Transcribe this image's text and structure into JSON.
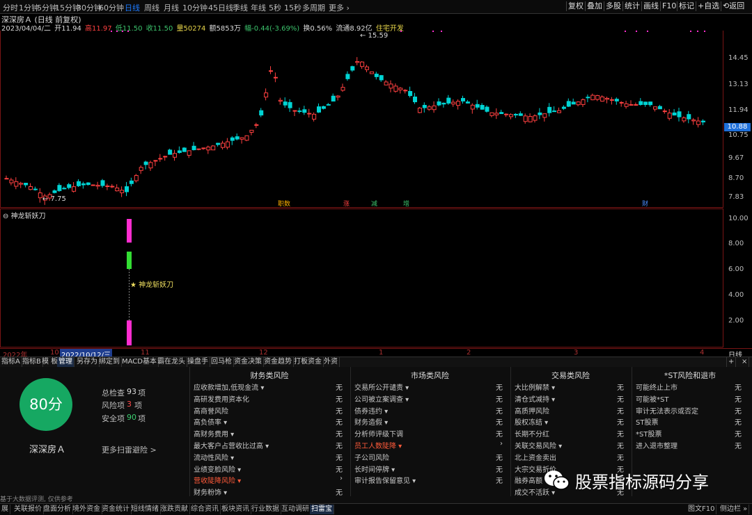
{
  "period_bar": {
    "items": [
      "分时",
      "1分钟",
      "5分钟",
      "15分钟",
      "30分钟",
      "60分钟",
      "日线",
      "周线",
      "月线",
      "10分钟",
      "45日线",
      "季线",
      "年线",
      "5秒",
      "15秒",
      "多周期",
      "更多 ›"
    ],
    "selected": "日线",
    "right_items": [
      "复权",
      "叠加",
      "多股",
      "统计",
      "画线",
      "F10",
      "标记",
      "+自选",
      "⟲返回"
    ]
  },
  "info": {
    "title": "深深房Ａ (日线 前复权)",
    "date": "2023/04/04/二",
    "open": "开11.94",
    "high": "高11.97",
    "low": "低11.50",
    "close": "收11.50",
    "volume": "量50274",
    "amount": "额5853万",
    "change": "幅-0.44(-3.69%)",
    "turnover": "换0.56%",
    "float": "流通8.92亿",
    "sector": "住宅开发"
  },
  "main_chart": {
    "y_ticks": [
      "14.45",
      "13.13",
      "11.94",
      "10.75",
      "9.67",
      "8.70",
      "7.83"
    ],
    "current_price": "10.88",
    "peak_label": "15.59",
    "low_label": "7.75",
    "markers": [
      "职数",
      "涨",
      "减",
      "增",
      "财"
    ]
  },
  "indicator": {
    "name": "神龙斩妖刀",
    "signal_label": "★ 神龙斩妖刀",
    "y_ticks": [
      "10.00",
      "8.00",
      "6.00",
      "4.00",
      "2.00"
    ]
  },
  "date_axis": {
    "labels": [
      "2022年",
      "10",
      "2022/10/12/三",
      "11",
      "12",
      "1",
      "2",
      "3",
      "4"
    ],
    "right_label": "日线"
  },
  "tabs": {
    "items": [
      "指标A",
      "指标B",
      "模 板",
      "管理",
      "另存为",
      "绑定到",
      "MACD基本",
      "霸在龙头",
      "操盘手",
      "回马枪",
      "资金决策",
      "资金趋势",
      "打板资金",
      "外资"
    ],
    "active": "管理"
  },
  "scan": {
    "score": "80分",
    "stock_name": "深深房Ａ",
    "total_label": "总检查",
    "total_value": "93",
    "risk_label": "风险项",
    "risk_value": "3",
    "safe_label": "安全项",
    "safe_value": "90",
    "unit": "项",
    "more_link": "更多扫雷避险 >",
    "footer_note": "基于大数据评测, 仅供参考",
    "columns": [
      {
        "title": "财务类风险",
        "items": [
          {
            "label": "应收款增加,低现金流 ▾",
            "status": "无"
          },
          {
            "label": "高研发费用资本化",
            "status": "无"
          },
          {
            "label": "高商誉风险",
            "status": "无"
          },
          {
            "label": "高负债率 ▾",
            "status": "无"
          },
          {
            "label": "高财务费用 ▾",
            "status": "无"
          },
          {
            "label": "最大客户占营收比过高 ▾",
            "status": "无"
          },
          {
            "label": "流动性风险 ▾",
            "status": "无"
          },
          {
            "label": "业绩变脸风险 ▾",
            "status": "无"
          },
          {
            "label": "营收陡降风险 ▾",
            "status": "›",
            "risk": true
          },
          {
            "label": "财务粉饰 ▾",
            "status": "无"
          }
        ]
      },
      {
        "title": "市场类风险",
        "items": [
          {
            "label": "交易所公开谴责 ▾",
            "status": "无"
          },
          {
            "label": "公司被立案调查 ▾",
            "status": "无"
          },
          {
            "label": "债券违约 ▾",
            "status": "无"
          },
          {
            "label": "财务造假 ▾",
            "status": "无"
          },
          {
            "label": "分析师评级下调",
            "status": "无"
          },
          {
            "label": "员工人数陡降 ▾",
            "status": "›",
            "risk": true
          },
          {
            "label": "子公司风险",
            "status": "无"
          },
          {
            "label": "长时间停牌 ▾",
            "status": "无"
          },
          {
            "label": "审计报告保留意见 ▾",
            "status": "无"
          }
        ]
      },
      {
        "title": "交易类风险",
        "items": [
          {
            "label": "大比例解禁 ▾",
            "status": "无"
          },
          {
            "label": "清仓式减持 ▾",
            "status": "无"
          },
          {
            "label": "高质押风险",
            "status": "无"
          },
          {
            "label": "股权冻结 ▾",
            "status": "无"
          },
          {
            "label": "长期不分红",
            "status": "无"
          },
          {
            "label": "关联交易风险 ▾",
            "status": "无"
          },
          {
            "label": "北上资金卖出",
            "status": "无"
          },
          {
            "label": "大宗交易折价",
            "status": "无"
          },
          {
            "label": "融券高额",
            "status": "无"
          },
          {
            "label": "成交不活跃 ▾",
            "status": "无"
          }
        ]
      },
      {
        "title": "*ST风险和退市",
        "items": [
          {
            "label": "可能终止上市",
            "status": "无"
          },
          {
            "label": "可能被*ST",
            "status": "无"
          },
          {
            "label": "审计无法表示或否定",
            "status": "无"
          },
          {
            "label": "ST股票",
            "status": "无"
          },
          {
            "label": "*ST股票",
            "status": "无"
          },
          {
            "label": "进入退市整理",
            "status": "无"
          }
        ]
      }
    ]
  },
  "bottom_bar": {
    "items": [
      "展",
      "关联报价",
      "盘面分析",
      "境外资金",
      "资金统计",
      "短线情绪",
      "涨跌贡献",
      "综合资讯",
      "板块资讯",
      "行业数据",
      "互动调研",
      "扫雷宝"
    ],
    "active": "扫雷宝",
    "right_items": [
      "图文F10",
      "侧边栏 »"
    ]
  },
  "watermark": {
    "icon": "wechat-icon",
    "text": "股票指标源码分享"
  },
  "colors": {
    "up": "#ff4040",
    "down": "#00d4d4",
    "score": "#16a862",
    "magenta": "#ff2dd0",
    "green_bar": "#33dd33"
  }
}
